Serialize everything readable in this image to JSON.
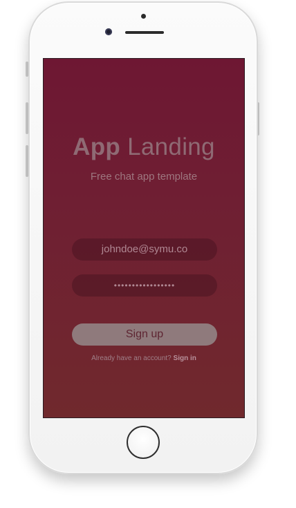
{
  "app": {
    "title_bold": "App",
    "title_light": "Landing",
    "subtitle": "Free chat app template"
  },
  "form": {
    "email_value": "johndoe@symu.co",
    "password_value": "•••••••••••••••••",
    "signup_label": "Sign up"
  },
  "footer": {
    "prompt": "Already have an account?",
    "signin_label": "Sign in"
  },
  "colors": {
    "screen_top": "#6e1733",
    "screen_bottom": "#70292d",
    "button": "#8f7a7c",
    "phone_body": "#f5f5f5"
  },
  "icons": {
    "camera": "front-camera-icon",
    "home": "home-button-icon"
  }
}
